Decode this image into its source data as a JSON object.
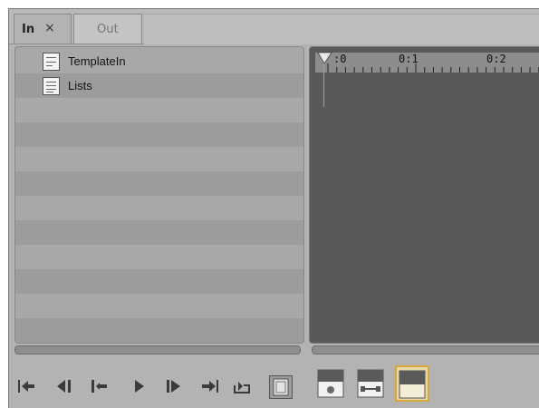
{
  "tabs": [
    {
      "label": "In",
      "active": true,
      "close_glyph": "×"
    },
    {
      "label": "Out",
      "active": false
    }
  ],
  "bin": {
    "items": [
      {
        "label": "TemplateIn",
        "icon": "template-icon"
      },
      {
        "label": "Lists",
        "icon": "list-icon"
      }
    ]
  },
  "timeline": {
    "ruler_labels": [
      ":0",
      "0:1",
      "0:2"
    ]
  },
  "toolbar": {
    "buttons": [
      "go-to-start-icon",
      "step-back-icon",
      "step-forward-icon",
      "play-icon",
      "play-frame-icon",
      "go-to-end-icon",
      "loop-icon",
      "safe-margins-icon",
      "view-source-icon",
      "view-timeline-icon",
      "view-both-icon"
    ],
    "active_button": "view-both-icon"
  },
  "colors": {
    "panel": "#a8a8a8",
    "timeline_bg": "#595959",
    "accent_active": "#d4a93a"
  }
}
